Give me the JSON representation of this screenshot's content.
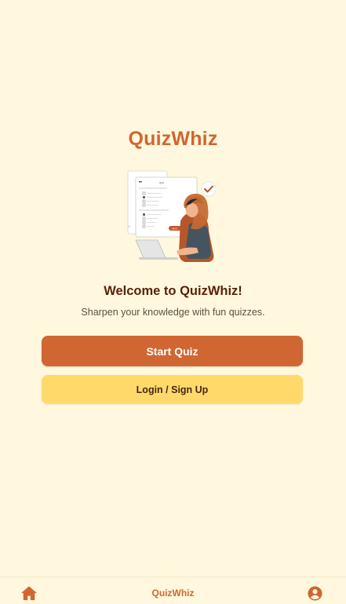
{
  "app": {
    "brand_title": "QuizWhiz"
  },
  "hero": {
    "illustration_icon": "woman-taking-quiz-on-laptop-illustration",
    "quiz_sheet_title": "Quiz",
    "next_label": "NEXT"
  },
  "welcome": {
    "heading": "Welcome to QuizWhiz!",
    "tagline": "Sharpen your knowledge with fun quizzes."
  },
  "actions": {
    "start_label": "Start Quiz",
    "login_label": "Login / Sign Up"
  },
  "bottom_nav": {
    "home_icon": "home-icon",
    "title": "QuizWhiz",
    "profile_icon": "user-circle-icon"
  },
  "colors": {
    "background": "#FFF8DE",
    "accent": "#D06631",
    "secondary_button": "#FFDA6B",
    "heading_text": "#5A1F08"
  }
}
